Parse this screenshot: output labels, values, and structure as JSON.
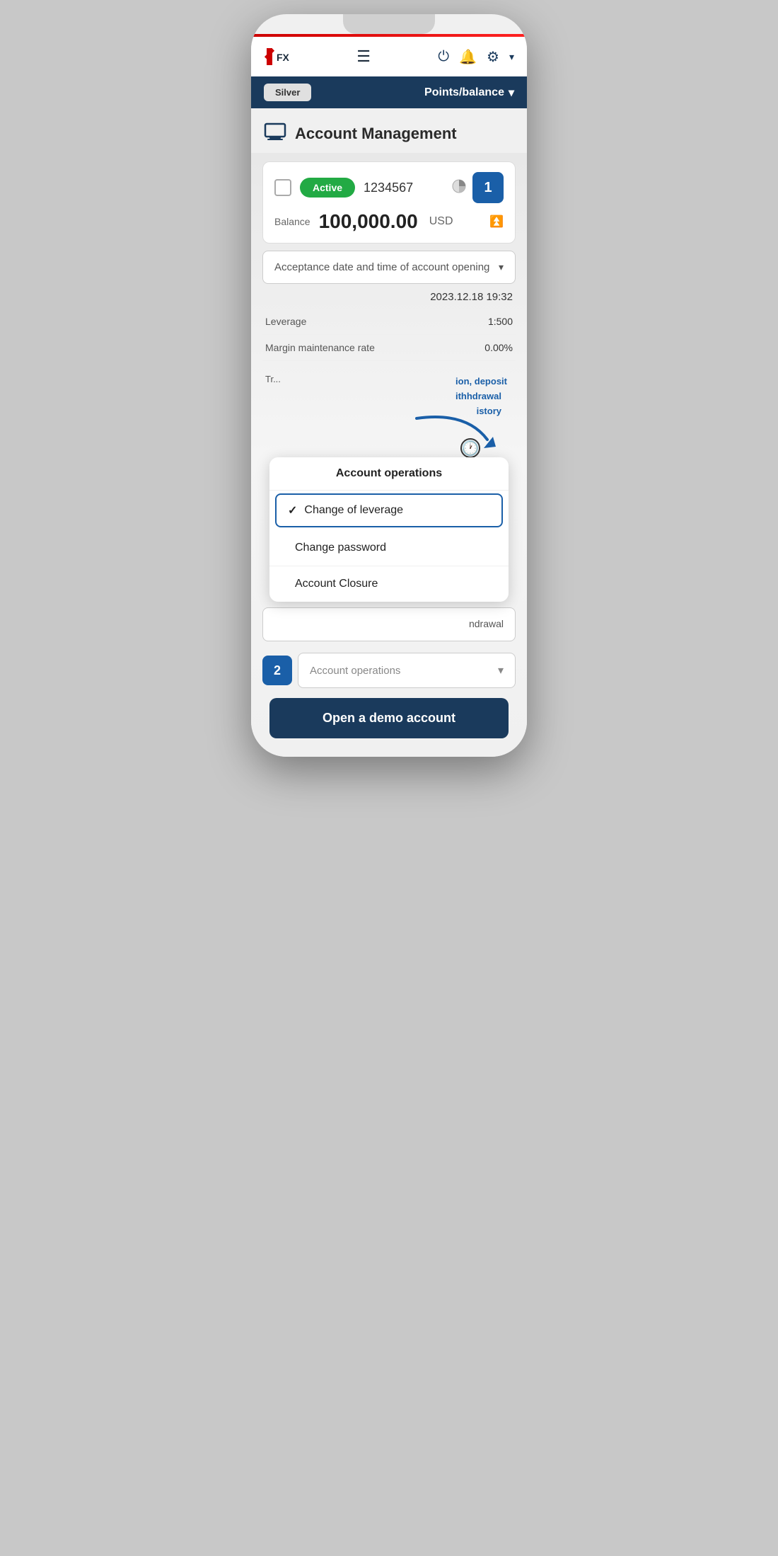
{
  "phone": {
    "red_line": true
  },
  "header": {
    "logo_text": "FXON",
    "hamburger_label": "☰",
    "icons": {
      "power": "⏻",
      "bell": "🔔",
      "gear": "⚙",
      "chevron": "▾"
    }
  },
  "nav_bar": {
    "silver_label": "Silver",
    "points_balance_label": "Points/balance",
    "chevron": "▾"
  },
  "page": {
    "title": "Account Management",
    "title_icon": "🖥"
  },
  "account_card": {
    "active_label": "Active",
    "account_number": "1234567",
    "balance_label": "Balance",
    "balance_amount": "100,000.00",
    "balance_currency": "USD",
    "number_badge": "1"
  },
  "acceptance_dropdown": {
    "label": "Acceptance date and time of account opening",
    "chevron": "▾",
    "date_value": "2023.12.18 19:32"
  },
  "leverage": {
    "label": "Leverage",
    "value": "1:500"
  },
  "margin": {
    "label": "Margin maintenance rate",
    "value": "0.00%"
  },
  "account_operations_popup": {
    "title": "Account operations",
    "items": [
      {
        "label": "Change of leverage",
        "selected": true,
        "check": "✓"
      },
      {
        "label": "Change password",
        "selected": false,
        "check": ""
      },
      {
        "label": "Account Closure",
        "selected": false,
        "check": ""
      }
    ],
    "partial_right_text": "ion, deposit\nithhdrawal\nistory"
  },
  "section2": {
    "number": "2",
    "dropdown_placeholder": "Account operations",
    "chevron": "▾"
  },
  "open_demo_button": {
    "label": "Open a demo account"
  },
  "withdrawal_partial": {
    "text": "ndrawal"
  }
}
